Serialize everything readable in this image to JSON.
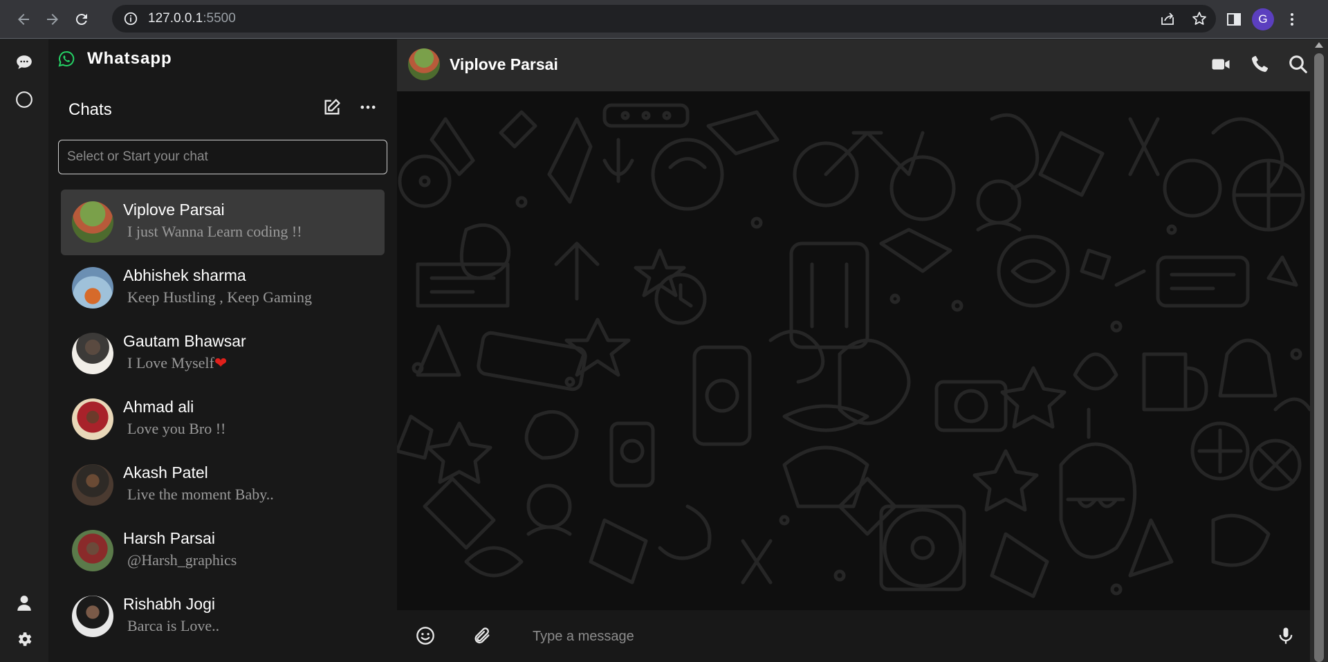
{
  "browser": {
    "url_host": "127.0.0.1",
    "url_port": ":5500",
    "profile_initial": "G"
  },
  "app": {
    "brand": "Whatsapp",
    "chats_title": "Chats",
    "search_placeholder": "Select or Start your chat"
  },
  "chats": [
    {
      "name": "Viplove Parsai",
      "message": "I just Wanna Learn coding !!",
      "active": true
    },
    {
      "name": "Abhishek sharma",
      "message": "Keep Hustling , Keep Gaming"
    },
    {
      "name": "Gautam Bhawsar",
      "message": "I Love Myself",
      "emoji": "❤"
    },
    {
      "name": "Ahmad ali",
      "message": "Love you Bro !!"
    },
    {
      "name": "Akash Patel",
      "message": "Live the moment Baby.."
    },
    {
      "name": "Harsh Parsai",
      "message": "@Harsh_graphics"
    },
    {
      "name": "Rishabh Jogi",
      "message": "Barca is Love.."
    }
  ],
  "conversation": {
    "contact_name": "Viplove Parsai",
    "input_placeholder": "Type a message"
  },
  "colors": {
    "brand_green": "#25d366",
    "heart_red": "#e0201b",
    "active_row": "#3a3a3a"
  }
}
